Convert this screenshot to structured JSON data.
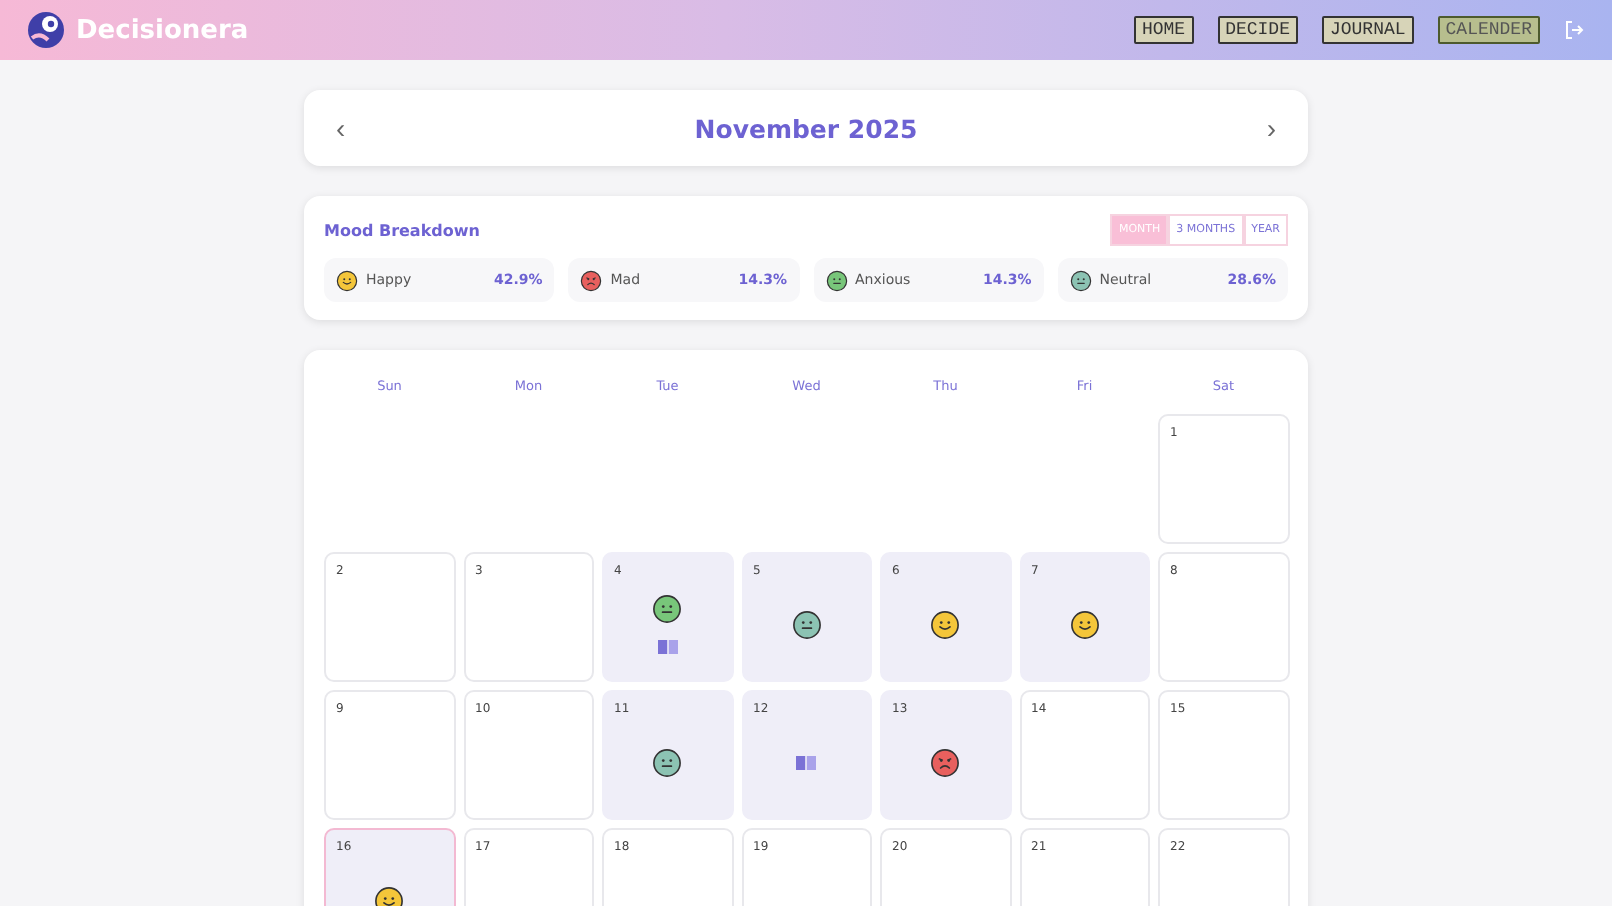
{
  "app": {
    "name": "Decisionera"
  },
  "nav": [
    {
      "label": "HOME",
      "selected": false
    },
    {
      "label": "DECIDE",
      "selected": false
    },
    {
      "label": "JOURNAL",
      "selected": false
    },
    {
      "label": "CALENDER",
      "selected": true
    }
  ],
  "month": {
    "prev": "‹",
    "title": "November 2025",
    "next": "›"
  },
  "mood_breakdown": {
    "title": "Mood Breakdown",
    "ranges": [
      {
        "label": "MONTH",
        "selected": true
      },
      {
        "label": "3 MONTHS",
        "selected": false
      },
      {
        "label": "YEAR",
        "selected": false
      }
    ],
    "moods": [
      {
        "kind": "happy",
        "label": "Happy",
        "percent": "42.9%"
      },
      {
        "kind": "mad",
        "label": "Mad",
        "percent": "14.3%"
      },
      {
        "kind": "anxious",
        "label": "Anxious",
        "percent": "14.3%"
      },
      {
        "kind": "neutral",
        "label": "Neutral",
        "percent": "28.6%"
      }
    ]
  },
  "calendar": {
    "weekdays": [
      "Sun",
      "Mon",
      "Tue",
      "Wed",
      "Thu",
      "Fri",
      "Sat"
    ],
    "weeks": [
      [
        {
          "kind": "blank"
        },
        {
          "kind": "blank"
        },
        {
          "kind": "blank"
        },
        {
          "kind": "blank"
        },
        {
          "kind": "blank"
        },
        {
          "kind": "blank"
        },
        {
          "kind": "day",
          "day": "1",
          "journal": false,
          "today": false
        }
      ],
      [
        {
          "kind": "day",
          "day": "2",
          "journal": false,
          "today": false
        },
        {
          "kind": "day",
          "day": "3",
          "journal": false,
          "today": false
        },
        {
          "kind": "day",
          "day": "4",
          "mood": {
            "kind": "anxious"
          },
          "journal": true,
          "today": false
        },
        {
          "kind": "day",
          "day": "5",
          "mood": {
            "kind": "neutral"
          },
          "journal": false,
          "today": false
        },
        {
          "kind": "day",
          "day": "6",
          "mood": {
            "kind": "happy"
          },
          "journal": false,
          "today": false
        },
        {
          "kind": "day",
          "day": "7",
          "mood": {
            "kind": "happy"
          },
          "journal": false,
          "today": false
        },
        {
          "kind": "day",
          "day": "8",
          "journal": false,
          "today": false
        }
      ],
      [
        {
          "kind": "day",
          "day": "9",
          "journal": false,
          "today": false
        },
        {
          "kind": "day",
          "day": "10",
          "journal": false,
          "today": false
        },
        {
          "kind": "day",
          "day": "11",
          "mood": {
            "kind": "neutral"
          },
          "journal": false,
          "today": false
        },
        {
          "kind": "day",
          "day": "12",
          "journal": true,
          "today": false
        },
        {
          "kind": "day",
          "day": "13",
          "mood": {
            "kind": "mad"
          },
          "journal": false,
          "today": false
        },
        {
          "kind": "day",
          "day": "14",
          "journal": false,
          "today": false
        },
        {
          "kind": "day",
          "day": "15",
          "journal": false,
          "today": false
        }
      ],
      [
        {
          "kind": "day",
          "day": "16",
          "mood": {
            "kind": "happy"
          },
          "journal": false,
          "today": true
        },
        {
          "kind": "day",
          "day": "17",
          "journal": false,
          "today": false
        },
        {
          "kind": "day",
          "day": "18",
          "journal": false,
          "today": false
        },
        {
          "kind": "day",
          "day": "19",
          "journal": false,
          "today": false
        },
        {
          "kind": "day",
          "day": "20",
          "journal": false,
          "today": false
        },
        {
          "kind": "day",
          "day": "21",
          "journal": false,
          "today": false
        },
        {
          "kind": "day",
          "day": "22",
          "journal": false,
          "today": false
        }
      ]
    ]
  }
}
